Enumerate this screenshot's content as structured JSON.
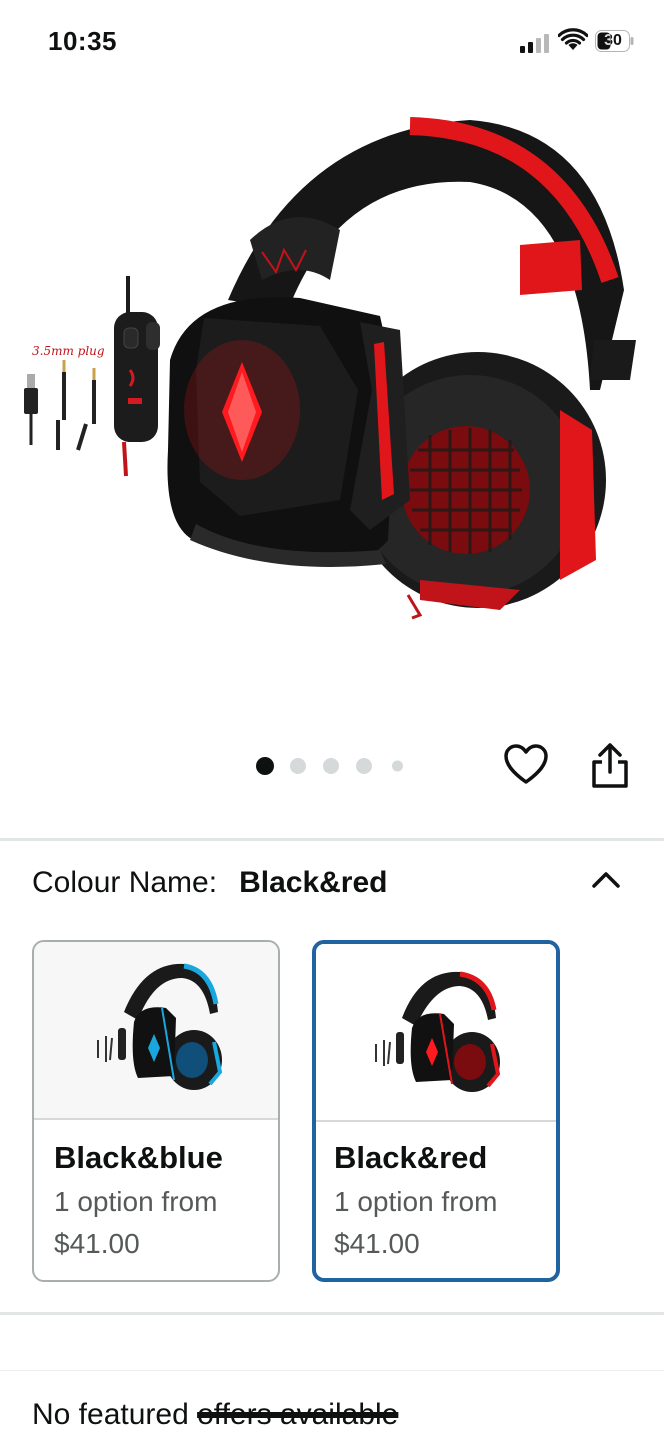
{
  "status_bar": {
    "time": "10:35",
    "battery": "30"
  },
  "product": {
    "image_alt": "black and red gaming headset",
    "carousel": {
      "total": 5,
      "active_index": 0
    }
  },
  "actions": {
    "favorite_icon": "heart-icon",
    "share_icon": "share-icon"
  },
  "variation": {
    "label": "Colour Name:",
    "selected": "Black&red",
    "collapse_icon": "chevron-up-icon",
    "options": [
      {
        "name": "Black&blue",
        "availability": "1 option from",
        "price": "$41.00",
        "accent": "#1aa7e0",
        "selected": false
      },
      {
        "name": "Black&red",
        "availability": "1 option from",
        "price": "$41.00",
        "accent": "#e0161b",
        "selected": true
      }
    ]
  },
  "offers": {
    "prefix": "No featured ",
    "struck": "offers available"
  },
  "colors": {
    "selected_border": "#2162a1",
    "divider": "#e3e6e6",
    "headset_red": "#e0161b",
    "headset_blue": "#1aa7e0"
  }
}
